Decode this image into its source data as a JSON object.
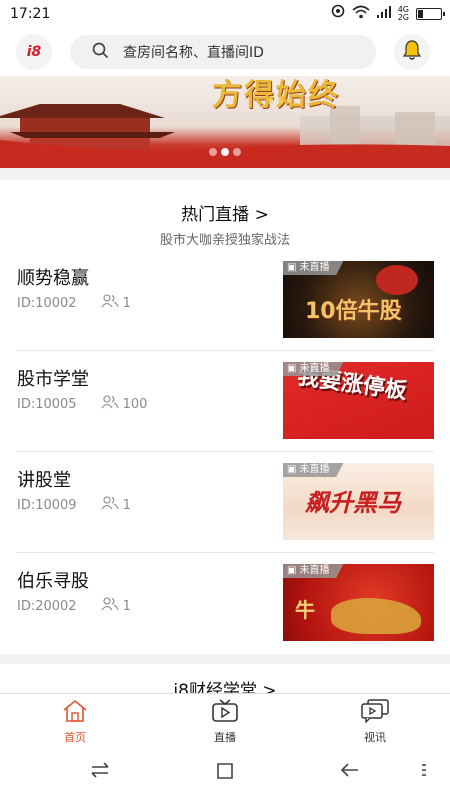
{
  "status_bar": {
    "time": "17:21",
    "net_top": "4G",
    "net_bottom": "2G"
  },
  "header": {
    "logo_text": "i8",
    "search_placeholder": "查房间名称、直播间ID"
  },
  "banner": {
    "title": "方得始终",
    "stars": "★★★",
    "slide_count": 3,
    "active_slide": 2
  },
  "hot_live": {
    "title": "热门直播 >",
    "subtitle": "股市大咖亲授独家战法",
    "rooms": [
      {
        "name": "顺势稳赢",
        "id": "ID:10002",
        "viewers": "1",
        "status": "未直播",
        "cover_text": "10倍牛股"
      },
      {
        "name": "股市学堂",
        "id": "ID:10005",
        "viewers": "100",
        "status": "未直播",
        "cover_text": "我要涨停板"
      },
      {
        "name": "讲股堂",
        "id": "ID:10009",
        "viewers": "1",
        "status": "未直播",
        "cover_text": "飙升黑马"
      },
      {
        "name": "伯乐寻股",
        "id": "ID:20002",
        "viewers": "1",
        "status": "未直播",
        "cover_text": "牛"
      }
    ]
  },
  "school": {
    "title": "i8财经学堂 >"
  },
  "tabbar": {
    "tabs": [
      {
        "label": "首页",
        "icon": "home-icon",
        "active": true
      },
      {
        "label": "直播",
        "icon": "tv-play-icon",
        "active": false
      },
      {
        "label": "视讯",
        "icon": "chat-video-icon",
        "active": false
      }
    ]
  },
  "colors": {
    "accent": "#e0522f",
    "logo": "#d4202a",
    "bell": "#f4c20d"
  }
}
